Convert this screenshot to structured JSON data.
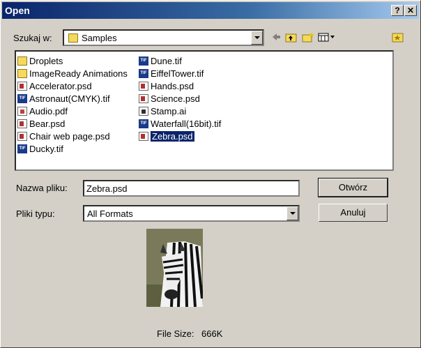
{
  "window": {
    "title": "Open"
  },
  "titlebar": {
    "help_label": "?",
    "close_label": "✕"
  },
  "lookin": {
    "label": "Szukaj w:",
    "value": "Samples"
  },
  "files": {
    "col1": [
      {
        "name": "Droplets",
        "type": "folder"
      },
      {
        "name": "ImageReady Animations",
        "type": "folder"
      },
      {
        "name": "Accelerator.psd",
        "type": "psd"
      },
      {
        "name": "Astronaut(CMYK).tif",
        "type": "tif"
      },
      {
        "name": "Audio.pdf",
        "type": "pdf"
      },
      {
        "name": "Bear.psd",
        "type": "psd"
      },
      {
        "name": "Chair web page.psd",
        "type": "psd"
      },
      {
        "name": "Ducky.tif",
        "type": "tif"
      }
    ],
    "col2": [
      {
        "name": "Dune.tif",
        "type": "tif"
      },
      {
        "name": "EiffelTower.tif",
        "type": "tif"
      },
      {
        "name": "Hands.psd",
        "type": "psd"
      },
      {
        "name": "Science.psd",
        "type": "psd"
      },
      {
        "name": "Stamp.ai",
        "type": "ai"
      },
      {
        "name": "Waterfall(16bit).tif",
        "type": "tif"
      },
      {
        "name": "Zebra.psd",
        "type": "psd",
        "selected": true
      }
    ]
  },
  "filename": {
    "label": "Nazwa pliku:",
    "value": "Zebra.psd"
  },
  "filetype": {
    "label": "Pliki typu:",
    "value": "All Formats"
  },
  "buttons": {
    "open": "Otwórz",
    "cancel": "Anuluj"
  },
  "filesize": {
    "label": "File Size:",
    "value": "666K"
  },
  "tif_badge": "TIF"
}
